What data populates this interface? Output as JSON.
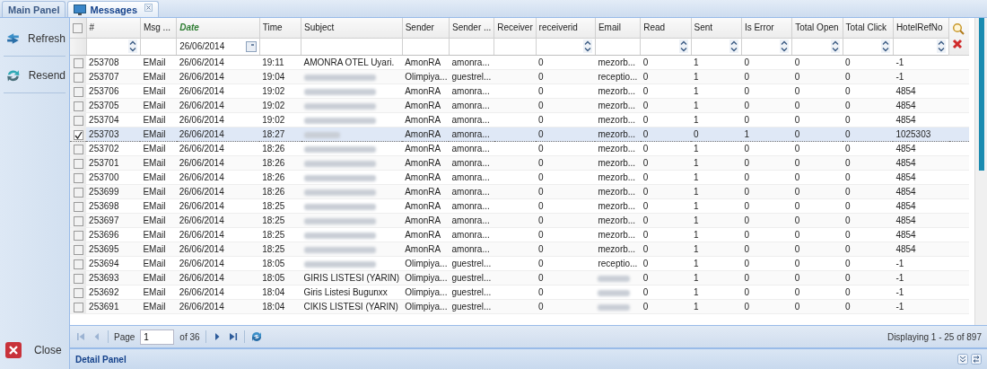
{
  "tabs": [
    {
      "label": "Main Panel",
      "selected": false,
      "closable": false
    },
    {
      "label": "Messages",
      "selected": true,
      "closable": true
    }
  ],
  "sidebar": {
    "actions": [
      {
        "label": "Refresh",
        "kind": "refresh"
      },
      {
        "label": "Resend",
        "kind": "resend"
      },
      {
        "label": "Close",
        "kind": "close"
      }
    ]
  },
  "table": {
    "select_all_checked": false,
    "columns": [
      {
        "label": "#",
        "kind": "number",
        "filtered": false
      },
      {
        "label": "Msg ...",
        "kind": "text",
        "filtered": false
      },
      {
        "label": "Date",
        "kind": "date",
        "filter_value": "26/06/2014",
        "filtered": true
      },
      {
        "label": "Time",
        "kind": "text",
        "filtered": false
      },
      {
        "label": "Subject",
        "kind": "text",
        "filtered": false
      },
      {
        "label": "Sender",
        "kind": "text",
        "filtered": false
      },
      {
        "label": "Sender ...",
        "kind": "text",
        "filtered": false
      },
      {
        "label": "Receiver",
        "kind": "text",
        "filtered": false
      },
      {
        "label": "receiverid",
        "kind": "number",
        "filtered": false
      },
      {
        "label": "Email",
        "kind": "text",
        "filtered": false
      },
      {
        "label": "Read",
        "kind": "number",
        "filtered": false
      },
      {
        "label": "Sent",
        "kind": "number",
        "filtered": false
      },
      {
        "label": "Is Error",
        "kind": "number",
        "filtered": false
      },
      {
        "label": "Total Open",
        "kind": "number",
        "filtered": false
      },
      {
        "label": "Total Click",
        "kind": "number",
        "filtered": false
      },
      {
        "label": "HotelRefNo",
        "kind": "number",
        "filtered": false
      }
    ],
    "rows": [
      {
        "checked": false,
        "selected": false,
        "subject_blurred": false,
        "email_blurred": false,
        "cells": [
          "253708",
          "EMail",
          "26/06/2014",
          "19:11",
          "AMONRA OTEL Uyari.",
          "AmonRA",
          "amonra...",
          "",
          "0",
          "mezorb...",
          "0",
          "1",
          "0",
          "0",
          "0",
          "-1"
        ]
      },
      {
        "checked": false,
        "selected": false,
        "subject_blurred": true,
        "email_blurred": false,
        "cells": [
          "253707",
          "EMail",
          "26/06/2014",
          "19:04",
          "",
          "Olimpiya...",
          "guestrel...",
          "",
          "0",
          "receptio...",
          "0",
          "1",
          "0",
          "0",
          "0",
          "-1"
        ]
      },
      {
        "checked": false,
        "selected": false,
        "subject_blurred": true,
        "email_blurred": false,
        "cells": [
          "253706",
          "EMail",
          "26/06/2014",
          "19:02",
          "",
          "AmonRA",
          "amonra...",
          "",
          "0",
          "mezorb...",
          "0",
          "1",
          "0",
          "0",
          "0",
          "4854"
        ]
      },
      {
        "checked": false,
        "selected": false,
        "subject_blurred": true,
        "email_blurred": false,
        "cells": [
          "253705",
          "EMail",
          "26/06/2014",
          "19:02",
          "",
          "AmonRA",
          "amonra...",
          "",
          "0",
          "mezorb...",
          "0",
          "1",
          "0",
          "0",
          "0",
          "4854"
        ]
      },
      {
        "checked": false,
        "selected": false,
        "subject_blurred": true,
        "email_blurred": false,
        "cells": [
          "253704",
          "EMail",
          "26/06/2014",
          "19:02",
          "",
          "AmonRA",
          "amonra...",
          "",
          "0",
          "mezorb...",
          "0",
          "1",
          "0",
          "0",
          "0",
          "4854"
        ]
      },
      {
        "checked": true,
        "selected": true,
        "subject_blurred": true,
        "email_blurred": false,
        "cells": [
          "253703",
          "EMail",
          "26/06/2014",
          "18:27",
          "",
          "AmonRA",
          "amonra...",
          "",
          "0",
          "mezorb...",
          "0",
          "0",
          "1",
          "0",
          "0",
          "1025303"
        ]
      },
      {
        "checked": false,
        "selected": false,
        "subject_blurred": true,
        "email_blurred": false,
        "cells": [
          "253702",
          "EMail",
          "26/06/2014",
          "18:26",
          "",
          "AmonRA",
          "amonra...",
          "",
          "0",
          "mezorb...",
          "0",
          "1",
          "0",
          "0",
          "0",
          "4854"
        ]
      },
      {
        "checked": false,
        "selected": false,
        "subject_blurred": true,
        "email_blurred": false,
        "cells": [
          "253701",
          "EMail",
          "26/06/2014",
          "18:26",
          "",
          "AmonRA",
          "amonra...",
          "",
          "0",
          "mezorb...",
          "0",
          "1",
          "0",
          "0",
          "0",
          "4854"
        ]
      },
      {
        "checked": false,
        "selected": false,
        "subject_blurred": true,
        "email_blurred": false,
        "cells": [
          "253700",
          "EMail",
          "26/06/2014",
          "18:26",
          "",
          "AmonRA",
          "amonra...",
          "",
          "0",
          "mezorb...",
          "0",
          "1",
          "0",
          "0",
          "0",
          "4854"
        ]
      },
      {
        "checked": false,
        "selected": false,
        "subject_blurred": true,
        "email_blurred": false,
        "cells": [
          "253699",
          "EMail",
          "26/06/2014",
          "18:26",
          "",
          "AmonRA",
          "amonra...",
          "",
          "0",
          "mezorb...",
          "0",
          "1",
          "0",
          "0",
          "0",
          "4854"
        ]
      },
      {
        "checked": false,
        "selected": false,
        "subject_blurred": true,
        "email_blurred": false,
        "cells": [
          "253698",
          "EMail",
          "26/06/2014",
          "18:25",
          "",
          "AmonRA",
          "amonra...",
          "",
          "0",
          "mezorb...",
          "0",
          "1",
          "0",
          "0",
          "0",
          "4854"
        ]
      },
      {
        "checked": false,
        "selected": false,
        "subject_blurred": true,
        "email_blurred": false,
        "cells": [
          "253697",
          "EMail",
          "26/06/2014",
          "18:25",
          "",
          "AmonRA",
          "amonra...",
          "",
          "0",
          "mezorb...",
          "0",
          "1",
          "0",
          "0",
          "0",
          "4854"
        ]
      },
      {
        "checked": false,
        "selected": false,
        "subject_blurred": true,
        "email_blurred": false,
        "cells": [
          "253696",
          "EMail",
          "26/06/2014",
          "18:25",
          "",
          "AmonRA",
          "amonra...",
          "",
          "0",
          "mezorb...",
          "0",
          "1",
          "0",
          "0",
          "0",
          "4854"
        ]
      },
      {
        "checked": false,
        "selected": false,
        "subject_blurred": true,
        "email_blurred": false,
        "cells": [
          "253695",
          "EMail",
          "26/06/2014",
          "18:25",
          "",
          "AmonRA",
          "amonra...",
          "",
          "0",
          "mezorb...",
          "0",
          "1",
          "0",
          "0",
          "0",
          "4854"
        ]
      },
      {
        "checked": false,
        "selected": false,
        "subject_blurred": true,
        "email_blurred": false,
        "cells": [
          "253694",
          "EMail",
          "26/06/2014",
          "18:05",
          "",
          "Olimpiya...",
          "guestrel...",
          "",
          "0",
          "receptio...",
          "0",
          "1",
          "0",
          "0",
          "0",
          "-1"
        ]
      },
      {
        "checked": false,
        "selected": false,
        "subject_blurred": false,
        "email_blurred": true,
        "cells": [
          "253693",
          "EMail",
          "26/06/2014",
          "18:05",
          "GIRIS LISTESI (YARIN)",
          "Olimpiya...",
          "guestrel...",
          "",
          "0",
          "",
          "0",
          "1",
          "0",
          "0",
          "0",
          "-1"
        ]
      },
      {
        "checked": false,
        "selected": false,
        "subject_blurred": false,
        "email_blurred": true,
        "cells": [
          "253692",
          "EMail",
          "26/06/2014",
          "18:04",
          "Giris Listesi Bugunxx",
          "Olimpiya...",
          "guestrel...",
          "",
          "0",
          "",
          "0",
          "1",
          "0",
          "0",
          "0",
          "-1"
        ]
      },
      {
        "checked": false,
        "selected": false,
        "subject_blurred": false,
        "email_blurred": true,
        "cells": [
          "253691",
          "EMail",
          "26/06/2014",
          "18:04",
          "CIKIS LISTESI (YARIN)",
          "Olimpiya...",
          "guestrel...",
          "",
          "0",
          "",
          "0",
          "1",
          "0",
          "0",
          "0",
          "-1"
        ]
      }
    ]
  },
  "paging": {
    "page_label": "Page",
    "page": "1",
    "of_label": "of 36",
    "first_disabled": true,
    "prev_disabled": true,
    "status": "Displaying 1 - 25 of 897"
  },
  "detail_panel": {
    "title": "Detail Panel"
  }
}
